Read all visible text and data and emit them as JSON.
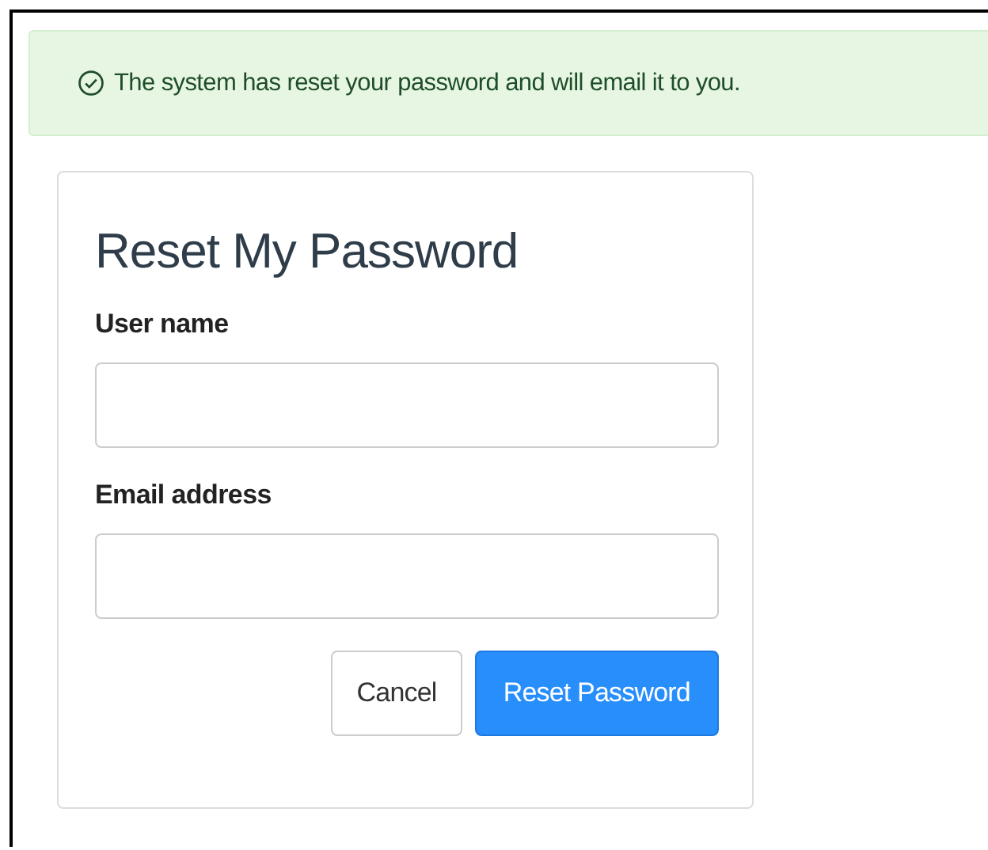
{
  "alert": {
    "kind": "success",
    "message": "The system has reset your password and will email it to you."
  },
  "form": {
    "title": "Reset My Password",
    "fields": [
      {
        "label": "User name"
      },
      {
        "label": "Email address"
      }
    ],
    "buttons": [
      {
        "label": "Cancel",
        "primary": false
      },
      {
        "label": "Reset Password",
        "primary": true
      }
    ]
  }
}
